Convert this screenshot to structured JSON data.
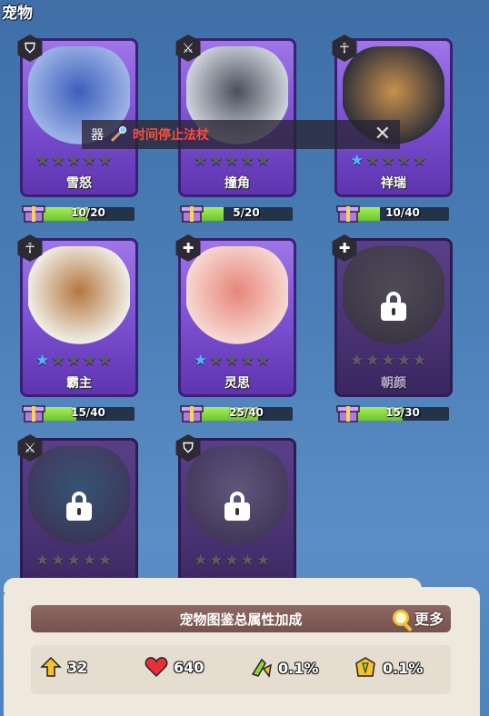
{
  "page_title": "宠物",
  "tooltip": {
    "slot_label": "器",
    "item_name": "时间停止法杖",
    "close_icon": "close-icon"
  },
  "pets": [
    {
      "name": "雪怒",
      "type_icon": "shield-icon",
      "stars": 0,
      "progress_text": "10/20",
      "progress": 0.5,
      "locked": false,
      "colors": [
        "#3c5fbd",
        "#9fb4e6"
      ]
    },
    {
      "name": "撞角",
      "type_icon": "sword-icon",
      "stars": 0,
      "progress_text": "5/20",
      "progress": 0.25,
      "locked": false,
      "colors": [
        "#4b4f5c",
        "#cfd3dc"
      ]
    },
    {
      "name": "祥瑞",
      "type_icon": "ankh-icon",
      "stars": 1,
      "progress_text": "10/40",
      "progress": 0.25,
      "locked": false,
      "colors": [
        "#c9914d",
        "#303038"
      ]
    },
    {
      "name": "霸主",
      "type_icon": "ankh-icon",
      "stars": 1,
      "progress_text": "15/40",
      "progress": 0.375,
      "locked": false,
      "colors": [
        "#b5773f",
        "#f0efe8"
      ]
    },
    {
      "name": "灵思",
      "type_icon": "heal-icon",
      "stars": 1,
      "progress_text": "25/40",
      "progress": 0.625,
      "locked": false,
      "colors": [
        "#e8857a",
        "#f6d9d2"
      ]
    },
    {
      "name": "朝颜",
      "type_icon": "heal-icon",
      "stars": 0,
      "progress_text": "15/30",
      "progress": 0.5,
      "locked": true,
      "colors": [
        "#4d5a34",
        "#2f3a22"
      ]
    },
    {
      "name": "",
      "type_icon": "sword-icon",
      "stars": 0,
      "progress_text": "",
      "progress": 0,
      "locked": true,
      "colors": [
        "#1f6b6b",
        "#2d3a44"
      ]
    },
    {
      "name": "",
      "type_icon": "shield-icon",
      "stars": 0,
      "progress_text": "",
      "progress": 0,
      "locked": true,
      "colors": [
        "#6b6f78",
        "#3a3d46"
      ]
    }
  ],
  "bonus_panel": {
    "title": "宠物图鉴总属性加成",
    "more_label": "更多",
    "stats": [
      {
        "icon": "attack-up-icon",
        "value": "32",
        "color": "#f5c22b"
      },
      {
        "icon": "heart-icon",
        "value": "640",
        "color": "#e8303a"
      },
      {
        "icon": "crit-icon",
        "value": "0.1%",
        "color": "#8fd23a"
      },
      {
        "icon": "crit-damage-icon",
        "value": "0.1%",
        "color": "#f5c22b"
      }
    ]
  }
}
